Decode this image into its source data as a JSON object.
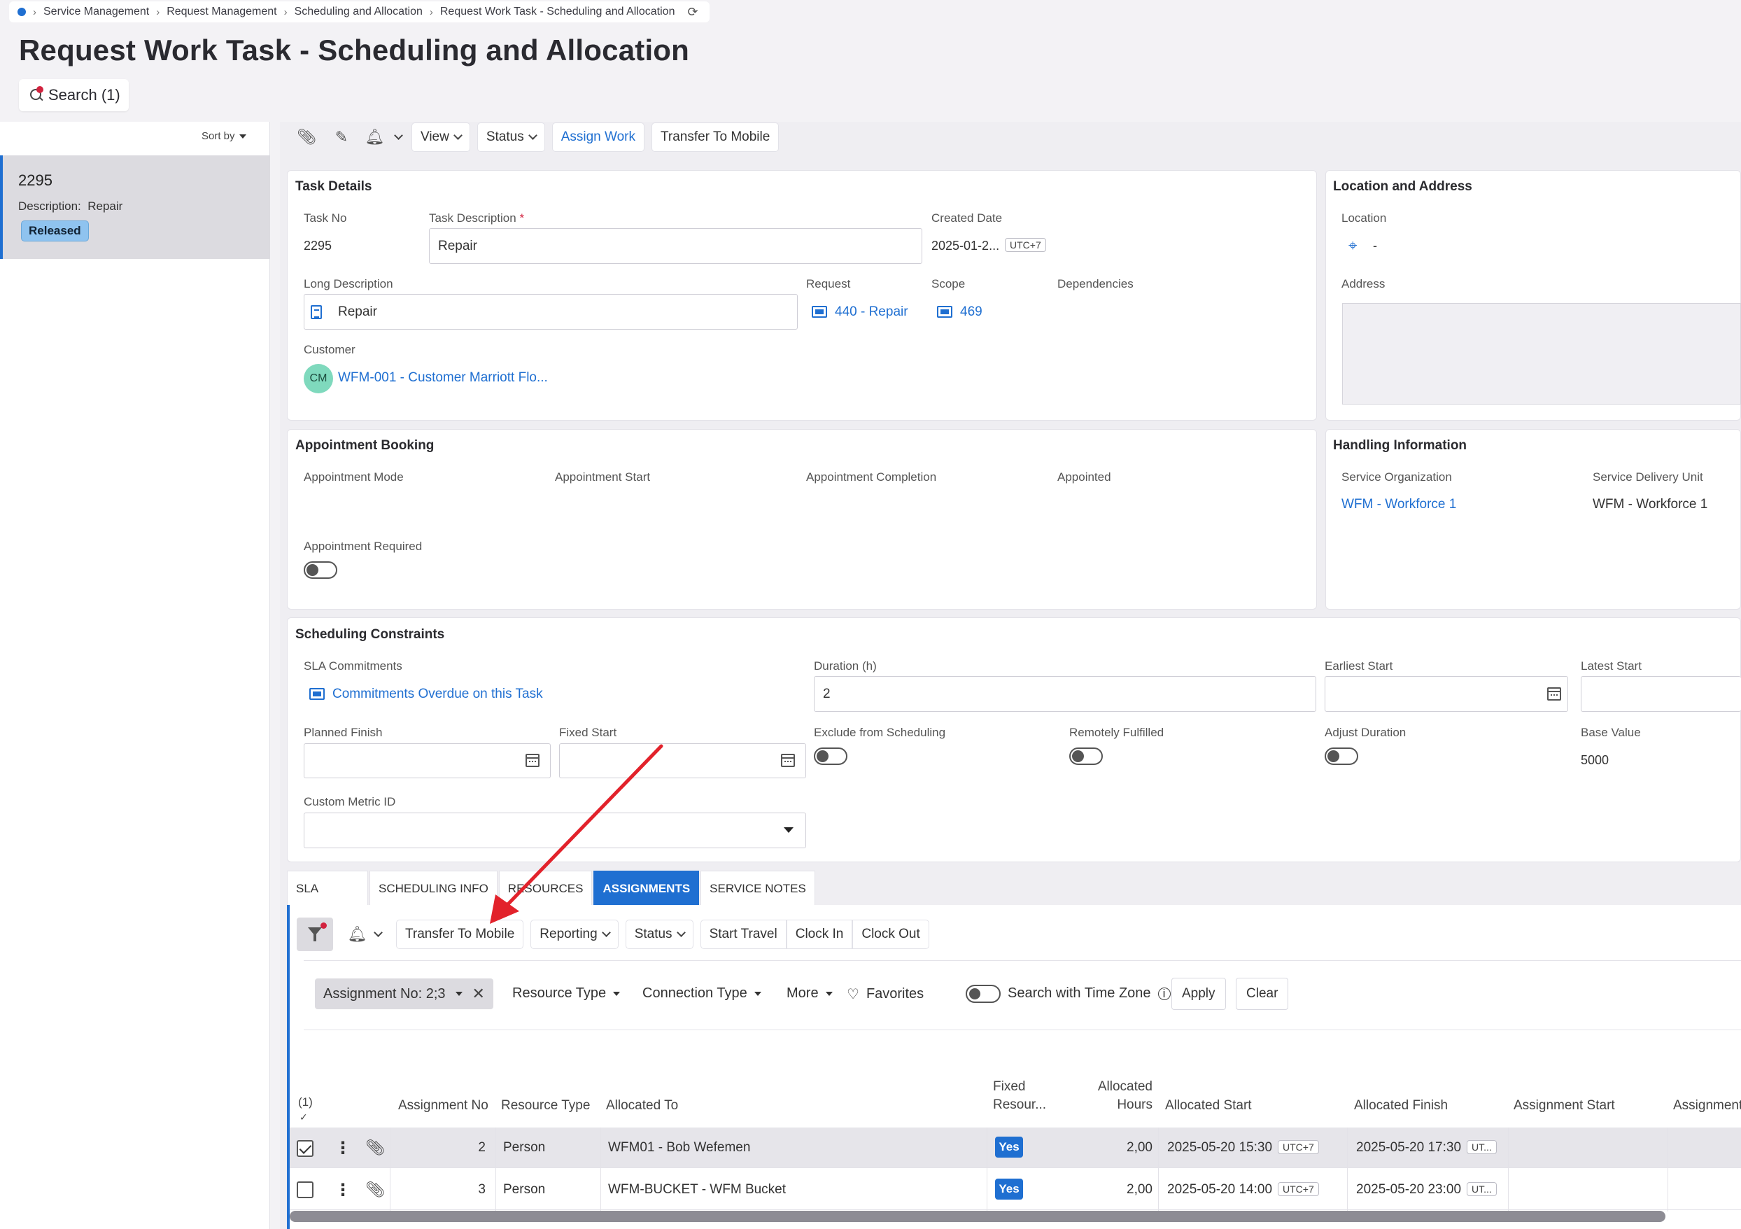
{
  "breadcrumb": {
    "items": [
      "Service Management",
      "Request Management",
      "Scheduling and Allocation",
      "Request Work Task - Scheduling and Allocation"
    ]
  },
  "page": {
    "title": "Request Work Task - Scheduling and Allocation",
    "search_label": "Search (1)"
  },
  "left_panel": {
    "sort_label": "Sort by",
    "record": {
      "number": "2295",
      "description_label": "Description:",
      "description": "Repair",
      "status": "Released"
    }
  },
  "toolbar": {
    "view": "View",
    "status": "Status",
    "assign_work": "Assign Work",
    "transfer_to_mobile": "Transfer To Mobile"
  },
  "task_details": {
    "title": "Task Details",
    "task_no_label": "Task No",
    "task_no": "2295",
    "task_desc_label": "Task Description",
    "task_desc": "Repair",
    "created_date_label": "Created Date",
    "created_date": "2025-01-2...",
    "created_tz": "UTC+7",
    "long_desc_label": "Long Description",
    "long_desc": "Repair",
    "request_label": "Request",
    "request": "440 - Repair",
    "scope_label": "Scope",
    "scope": "469",
    "dependencies_label": "Dependencies",
    "customer_label": "Customer",
    "customer_initials": "CM",
    "customer": "WFM-001 - Customer Marriott Flo..."
  },
  "location": {
    "title": "Location and Address",
    "location_label": "Location",
    "location_value": "-",
    "address_label": "Address"
  },
  "appointment": {
    "title": "Appointment Booking",
    "mode_label": "Appointment Mode",
    "start_label": "Appointment Start",
    "completion_label": "Appointment Completion",
    "appointed_label": "Appointed",
    "required_label": "Appointment Required"
  },
  "handling": {
    "title": "Handling Information",
    "service_org_label": "Service Organization",
    "service_org": "WFM - Workforce 1",
    "sdu_label": "Service Delivery Unit",
    "sdu": "WFM - Workforce 1"
  },
  "scheduling": {
    "title": "Scheduling Constraints",
    "sla_label": "SLA Commitments",
    "sla_link": "Commitments Overdue on this Task",
    "duration_label": "Duration (h)",
    "duration": "2",
    "earliest_start_label": "Earliest Start",
    "latest_start_label": "Latest Start",
    "planned_finish_label": "Planned Finish",
    "fixed_start_label": "Fixed Start",
    "exclude_label": "Exclude from Scheduling",
    "remote_label": "Remotely Fulfilled",
    "adjust_label": "Adjust Duration",
    "base_value_label": "Base Value",
    "base_value": "5000",
    "custom_metric_label": "Custom Metric ID"
  },
  "tabs": [
    "SLA",
    "SCHEDULING INFO",
    "RESOURCES",
    "ASSIGNMENTS",
    "SERVICE NOTES"
  ],
  "assign_toolbar": {
    "transfer": "Transfer To Mobile",
    "reporting": "Reporting",
    "status": "Status",
    "start_travel": "Start Travel",
    "clock_in": "Clock In",
    "clock_out": "Clock Out"
  },
  "filters": {
    "chip": "Assignment No: 2;3",
    "resource_type": "Resource Type",
    "connection_type": "Connection Type",
    "more": "More",
    "favorites": "Favorites",
    "search_tz": "Search with Time Zone",
    "apply": "Apply",
    "clear": "Clear"
  },
  "table": {
    "selected_count": "(1)",
    "headers": {
      "assignment_no": "Assignment No",
      "resource_type": "Resource Type",
      "allocated_to": "Allocated To",
      "fixed_resource_1": "Fixed",
      "fixed_resource_2": "Resour...",
      "allocated_hours_1": "Allocated",
      "allocated_hours_2": "Hours",
      "allocated_start": "Allocated Start",
      "allocated_finish": "Allocated Finish",
      "assignment_start": "Assignment Start",
      "assignment_end": "Assignment"
    },
    "rows": [
      {
        "no": "2",
        "type": "Person",
        "allocated_to": "WFM01 - Bob Wefemen",
        "fixed": "Yes",
        "hours": "2,00",
        "start": "2025-05-20 15:30",
        "start_tz": "UTC+7",
        "finish": "2025-05-20 17:30",
        "finish_tz": "UT..."
      },
      {
        "no": "3",
        "type": "Person",
        "allocated_to": "WFM-BUCKET - WFM Bucket",
        "fixed": "Yes",
        "hours": "2,00",
        "start": "2025-05-20 14:00",
        "start_tz": "UTC+7",
        "finish": "2025-05-20 23:00",
        "finish_tz": "UT..."
      }
    ]
  },
  "colors": {
    "accent": "#1f6fd1",
    "annotation_arrow": "#e2222b",
    "badge": "#8fc3ef"
  }
}
